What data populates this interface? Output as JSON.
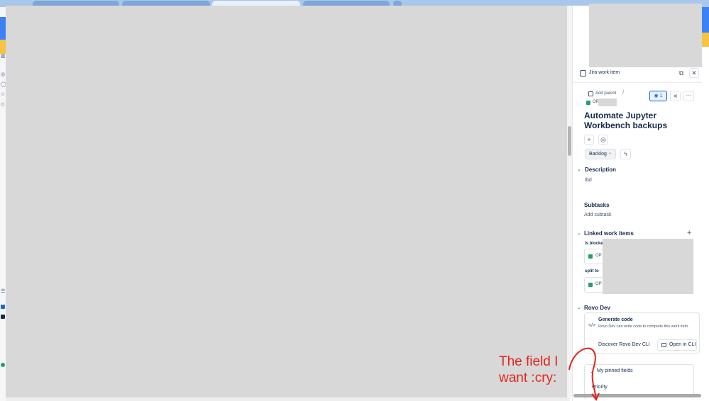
{
  "panel": {
    "header_title": "Jira work item",
    "add_parent": "Add parent",
    "breadcrumb_separator": "/",
    "item_key_prefix": "OP",
    "watchers_count": "1",
    "title": "Automate Jupyter Workbench backups",
    "status": "Backlog",
    "description": {
      "heading": "Description",
      "text": "tbd"
    },
    "subtasks": {
      "heading": "Subtasks",
      "add_label": "Add subtask"
    },
    "linked": {
      "heading": "Linked work items",
      "groups": [
        {
          "relation": "is blocked",
          "key_prefix": "OP"
        },
        {
          "relation": "split to",
          "key_prefix": "OP"
        }
      ]
    },
    "rovo": {
      "heading": "Rovo Dev",
      "card_title": "Generate code",
      "card_desc": "Rovo Dev can write code to complete this work item.",
      "discover_label": "Discover Rovo Dev CLI",
      "open_cli_label": "Open in CLI"
    },
    "pinned": {
      "heading": "My pinned fields",
      "first_field": "Priority"
    }
  },
  "annotation": {
    "text": "The field I want :cry:",
    "color": "#e0251b"
  },
  "colors": {
    "accent": "#0c66e4",
    "issue_type_green": "#22a06b",
    "redacted": "#d8d8d8"
  },
  "icons": {
    "header": "jira-work-item-icon",
    "open_external": "open-external-icon",
    "close": "close-icon",
    "watch": "eye-icon",
    "share": "share-icon",
    "more": "more-icon",
    "add": "plus-icon",
    "apps": "apps-icon",
    "automation": "lightning-icon",
    "code": "code-icon",
    "terminal": "terminal-icon"
  }
}
